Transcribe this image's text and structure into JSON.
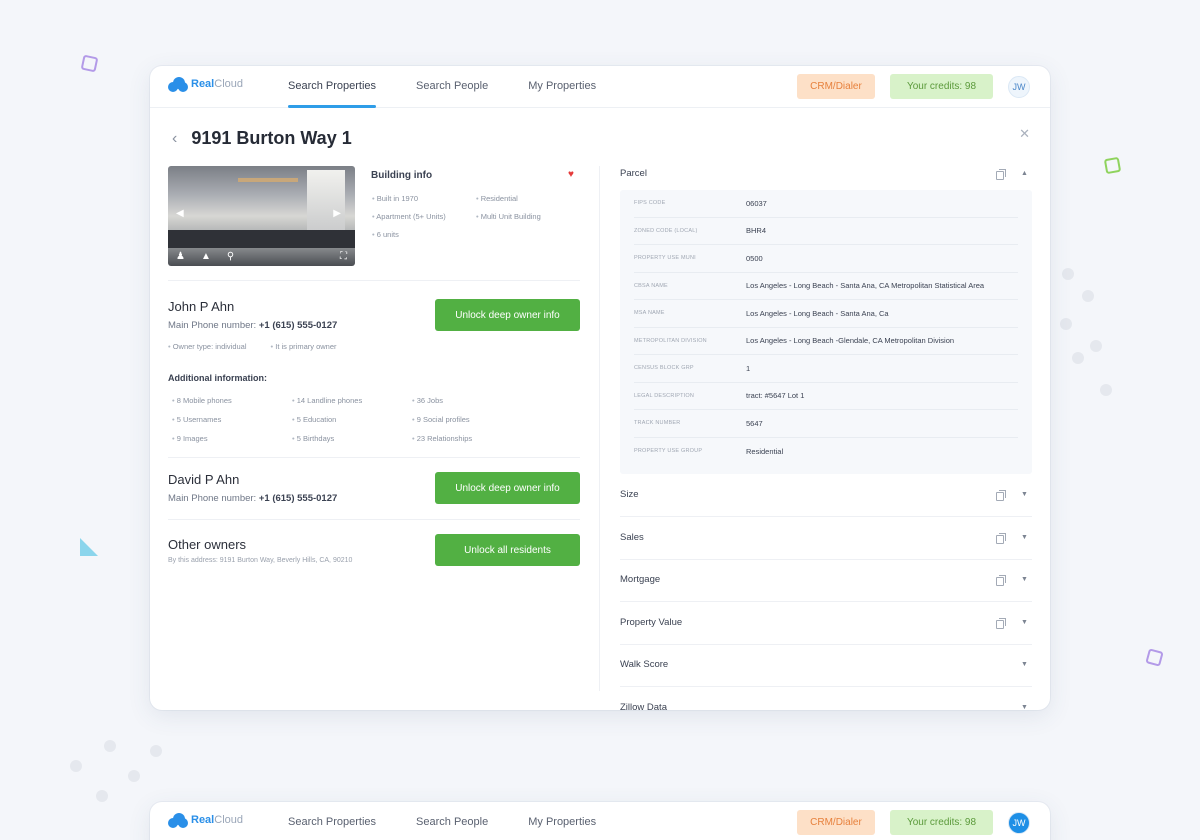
{
  "app": {
    "logo_text": "Real",
    "logo_text_light": "Cloud",
    "nav": [
      "Search Properties",
      "Search People",
      "My Properties"
    ],
    "crm_label": "CRM/Dialer",
    "credits_label": "Your credits: 98",
    "avatar_initials": "JW"
  },
  "page": {
    "title": "9191 Burton Way 1"
  },
  "building": {
    "title": "Building info",
    "facts": [
      "Built in 1970",
      "Residential",
      "Apartment (5+ Units)",
      "Multi Unit Building",
      "6 units"
    ]
  },
  "owners": [
    {
      "name": "John P Ahn",
      "phone_label": "Main Phone number:",
      "phone": "+1 (615) 555-0127",
      "meta": [
        "Owner type: individual",
        "It is primary owner"
      ],
      "unlock_label": "Unlock deep owner info"
    },
    {
      "name": "David P Ahn",
      "phone_label": "Main Phone number:",
      "phone": "+1 (615) 555-0127",
      "unlock_label": "Unlock deep owner info"
    }
  ],
  "additional": {
    "title": "Additional information:",
    "items": [
      "8 Mobile phones",
      "14 Landline phones",
      "36 Jobs",
      "5 Usernames",
      "5 Education",
      "9 Social profiles",
      "9 Images",
      "5 Birthdays",
      "23 Relationships"
    ]
  },
  "other_owners": {
    "title": "Other owners",
    "subtitle": "By this address: 9191 Burton Way, Beverly Hills, CA, 90210",
    "unlock_label": "Unlock all residents"
  },
  "parcel": {
    "title": "Parcel",
    "rows": [
      {
        "key": "FIPS CODE",
        "value": "06037"
      },
      {
        "key": "ZONED CODE (LOCAL)",
        "value": "BHR4"
      },
      {
        "key": "PROPERTY USE MUNI",
        "value": "0500"
      },
      {
        "key": "CBSA NAME",
        "value": "Los Angeles - Long Beach - Santa Ana, CA Metropolitan Statistical Area"
      },
      {
        "key": "MSA NAME",
        "value": "Los Angeles - Long Beach - Santa Ana, Ca"
      },
      {
        "key": "METROPOLITAN DIVISION",
        "value": "Los Angeles - Long Beach -Glendale, CA Metropolitan Division"
      },
      {
        "key": "CENSUS BLOCK GRP",
        "value": "1"
      },
      {
        "key": "LEGAL DESCRIPTION",
        "value": "tract: #5647 Lot 1"
      },
      {
        "key": "TRACK NUMBER",
        "value": "5647"
      },
      {
        "key": "PROPERTY USE GROUP",
        "value": "Residential"
      }
    ]
  },
  "sections": [
    "Size",
    "Sales",
    "Mortgage",
    "Property Value",
    "Walk Score",
    "Zillow Data"
  ]
}
